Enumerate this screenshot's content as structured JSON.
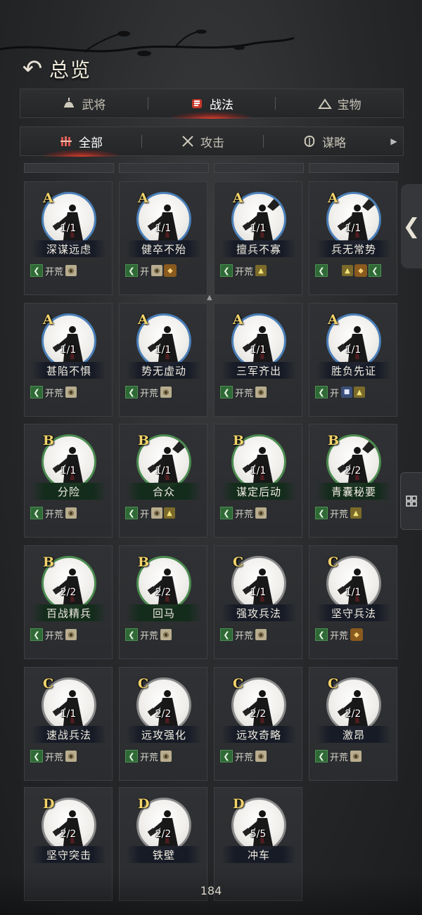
{
  "header": {
    "back_label": "",
    "title": "总览"
  },
  "main_tabs": [
    {
      "label": "武将",
      "icon": "helmet-icon",
      "active": false
    },
    {
      "label": "战法",
      "icon": "fist-icon",
      "active": true
    },
    {
      "label": "宝物",
      "icon": "treasure-icon",
      "active": false
    }
  ],
  "sub_tabs": [
    {
      "label": "全部",
      "icon": "scroll-bundle-icon",
      "active": true
    },
    {
      "label": "攻击",
      "icon": "crossed-swords-icon",
      "active": false
    },
    {
      "label": "谋略",
      "icon": "brain-icon",
      "active": false
    }
  ],
  "tag_label": "开荒",
  "tag_label_short": "开",
  "cards": [
    {
      "grade": "A",
      "count": "1/1",
      "name": "深谋远虑",
      "ring": "blue",
      "figure": "plain",
      "tags": [
        "arrow",
        "text",
        "bag"
      ]
    },
    {
      "grade": "A",
      "count": "1/1",
      "name": "健卒不殆",
      "ring": "blue",
      "figure": "plain",
      "tags": [
        "arrow",
        "short",
        "bag",
        "shield"
      ]
    },
    {
      "grade": "A",
      "count": "1/1",
      "name": "擅兵不寡",
      "ring": "blue",
      "figure": "fan",
      "tags": [
        "arrow",
        "text",
        "helm"
      ]
    },
    {
      "grade": "A",
      "count": "1/1",
      "name": "兵无常势",
      "ring": "blue",
      "figure": "fan",
      "tags": [
        "arrow",
        "tall",
        "helm",
        "shield",
        "arrow"
      ]
    },
    {
      "grade": "A",
      "count": "1/1",
      "name": "甚陷不惧",
      "ring": "blue",
      "figure": "plain",
      "tags": [
        "arrow",
        "text",
        "bag"
      ]
    },
    {
      "grade": "A",
      "count": "1/1",
      "name": "势无虚动",
      "ring": "blue",
      "figure": "plain",
      "tags": [
        "arrow",
        "text",
        "bag"
      ]
    },
    {
      "grade": "A",
      "count": "1/1",
      "name": "三军齐出",
      "ring": "blue",
      "figure": "plain",
      "tags": [
        "arrow",
        "text",
        "bag"
      ]
    },
    {
      "grade": "A",
      "count": "1/1",
      "name": "胜负先证",
      "ring": "blue",
      "figure": "plain",
      "tags": [
        "arrow",
        "short",
        "blue",
        "helm"
      ]
    },
    {
      "grade": "B",
      "count": "1/1",
      "name": "分险",
      "ring": "green",
      "figure": "plain",
      "tags": [
        "arrow",
        "text",
        "bag"
      ]
    },
    {
      "grade": "B",
      "count": "1/1",
      "name": "合众",
      "ring": "green",
      "figure": "fan",
      "tags": [
        "arrow",
        "short",
        "bag",
        "helm"
      ]
    },
    {
      "grade": "B",
      "count": "1/1",
      "name": "谋定后动",
      "ring": "green",
      "figure": "plain",
      "tags": [
        "arrow",
        "text",
        "bag"
      ]
    },
    {
      "grade": "B",
      "count": "2/2",
      "name": "青囊秘要",
      "ring": "green",
      "figure": "fan",
      "tags": [
        "arrow",
        "text",
        "helm"
      ]
    },
    {
      "grade": "B",
      "count": "2/2",
      "name": "百战精兵",
      "ring": "green",
      "figure": "plain",
      "tags": [
        "arrow",
        "text",
        "bag"
      ]
    },
    {
      "grade": "B",
      "count": "2/2",
      "name": "回马",
      "ring": "green",
      "figure": "plain",
      "tags": [
        "arrow",
        "text",
        "bag"
      ]
    },
    {
      "grade": "C",
      "count": "1/1",
      "name": "强攻兵法",
      "ring": "gray",
      "figure": "plain",
      "tags": [
        "arrow",
        "text",
        "bag"
      ]
    },
    {
      "grade": "C",
      "count": "1/1",
      "name": "坚守兵法",
      "ring": "gray",
      "figure": "plain",
      "tags": [
        "arrow",
        "text",
        "shield"
      ]
    },
    {
      "grade": "C",
      "count": "1/1",
      "name": "速战兵法",
      "ring": "gray",
      "figure": "plain",
      "tags": [
        "arrow",
        "text",
        "bag"
      ]
    },
    {
      "grade": "C",
      "count": "2/2",
      "name": "远攻强化",
      "ring": "gray",
      "figure": "plain",
      "tags": [
        "arrow",
        "text",
        "bag"
      ]
    },
    {
      "grade": "C",
      "count": "2/2",
      "name": "远攻奇略",
      "ring": "gray",
      "figure": "plain",
      "tags": [
        "arrow",
        "text",
        "bag"
      ]
    },
    {
      "grade": "C",
      "count": "2/2",
      "name": "激昂",
      "ring": "gray",
      "figure": "plain",
      "tags": [
        "arrow",
        "text",
        "bag"
      ]
    },
    {
      "grade": "D",
      "count": "2/2",
      "name": "坚守突击",
      "ring": "gray",
      "figure": "plain",
      "tags": []
    },
    {
      "grade": "D",
      "count": "2/2",
      "name": "铁壁",
      "ring": "gray",
      "figure": "plain",
      "tags": []
    },
    {
      "grade": "D",
      "count": "5/5",
      "name": "冲车",
      "ring": "gray",
      "figure": "plain",
      "tags": []
    }
  ],
  "page_number": "184",
  "colors": {
    "grade_gold": "#f2d36b",
    "ring_blue": "#4a7fb8",
    "ring_green": "#4b8b4f",
    "ring_gray": "#8a8a8a",
    "active_glow": "#e03a28"
  }
}
